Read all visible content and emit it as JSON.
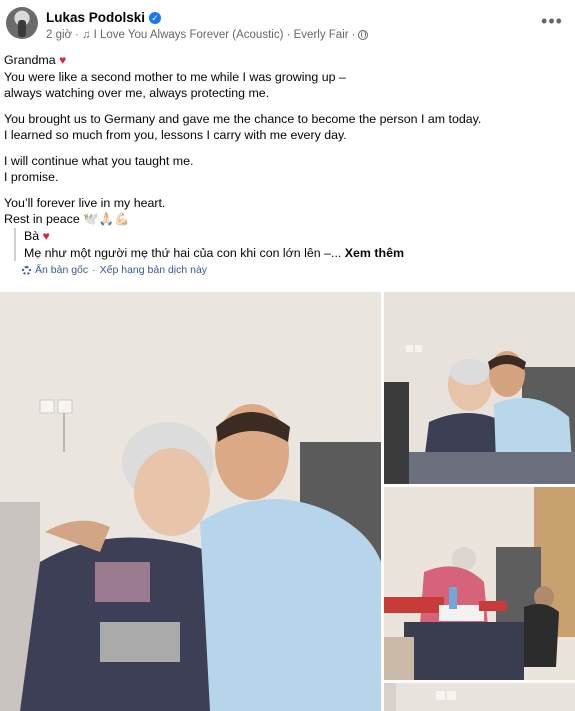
{
  "post": {
    "author": "Lukas Podolski",
    "verified_icon": "verified-badge-icon",
    "time": "2 giờ",
    "dot": "·",
    "music_icon": "music-note-icon",
    "song": "I Love You Always Forever (Acoustic) · Everly Fair",
    "privacy_icon": "globe-icon",
    "more_label": "•••"
  },
  "body": {
    "p1_l1": "Grandma",
    "heart": "♥",
    "p1_l2": "You were like a second mother to me while I was growing up –",
    "p1_l3": "always watching over me, always protecting me.",
    "p2_l1": "You brought us to Germany and gave me the chance to become the person I am today.",
    "p2_l2": "I learned so much from you, lessons I carry with me every day.",
    "p3_l1": "I will continue what you taught me.",
    "p3_l2": "I promise.",
    "p4_l1": "You’ll forever live in my heart.",
    "p4_l2": "Rest in peace",
    "p4_emoji": "🕊️🙏🏻💪🏻"
  },
  "translation": {
    "t1": "Bà",
    "heart": "♥",
    "t2": "Mẹ như một người mẹ thứ hai của con khi con lớn lên –...",
    "see_more": "Xem thêm",
    "hide_original": "Ẩn bản gốc",
    "sep": "·",
    "rate": "Xếp hạng bản dịch này"
  },
  "colors": {
    "accent": "#1877f2",
    "heart": "#e41e3f",
    "link": "#385898",
    "muted": "#65676b"
  }
}
